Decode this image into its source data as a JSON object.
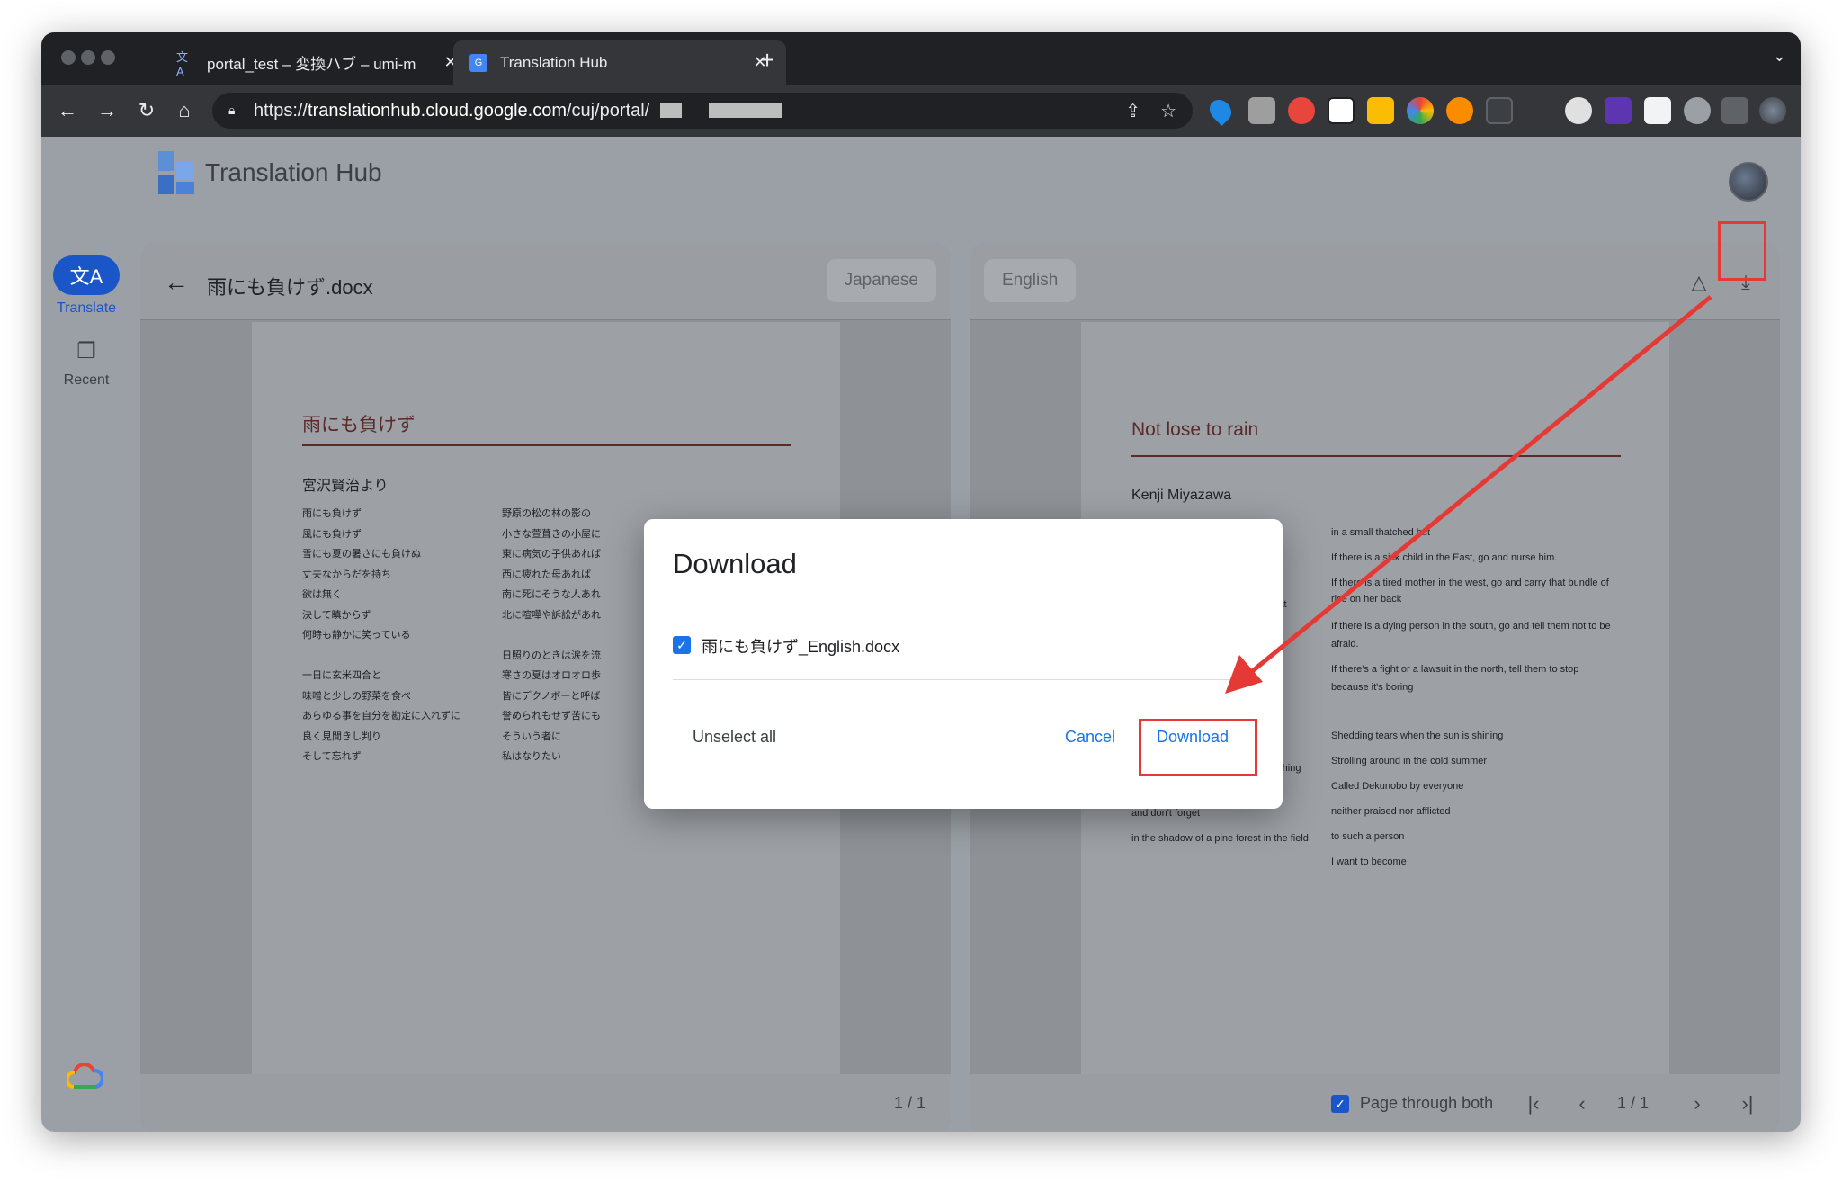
{
  "browser": {
    "tabs": [
      {
        "title": "portal_test – 変換ハブ – umi-m",
        "close": "✕"
      },
      {
        "title": "Translation Hub",
        "close": "✕"
      }
    ],
    "new_tab": "+",
    "tab_search": "⌄",
    "nav": {
      "back": "←",
      "forward": "→",
      "reload": "↻",
      "home": "⌂"
    },
    "url_prefix": "https://",
    "url_host": "translationhub.cloud.google.com",
    "url_path": "/cuj/portal/",
    "omnibox_icons": {
      "share": "⇪",
      "bookmark": "☆"
    }
  },
  "app": {
    "title": "Translation Hub",
    "rail": {
      "translate_label": "Translate",
      "recent_label": "Recent"
    },
    "left_panel": {
      "back": "←",
      "doc_title": "雨にも負けず.docx",
      "language": "Japanese",
      "doc": {
        "heading": "雨にも負けず",
        "author": "宮沢賢治より",
        "col1": [
          "雨にも負けず",
          "風にも負けず",
          "雪にも夏の暑さにも負けぬ",
          "丈夫なからだを持ち",
          "欲は無く",
          "決して瞋からず",
          "何時も静かに笑っている",
          "",
          "一日に玄米四合と",
          "味噌と少しの野菜を食べ",
          "あらゆる事を自分を勘定に入れずに",
          "良く見聞きし判り",
          "そして忘れず"
        ],
        "col2": [
          "野原の松の林の影の",
          "小さな萱葺きの小屋に",
          "東に病気の子供あれば",
          "西に疲れた母あれば",
          "南に死にそうな人あれ",
          "北に喧嘩や訴訟があれ",
          "",
          "日照りのときは涙を流",
          "寒さの夏はオロオロ歩",
          "皆にデクノボーと呼ば",
          "誉められもせず苦にも",
          "そういう者に",
          "私はなりたい"
        ]
      },
      "page_count": "1 / 1"
    },
    "right_panel": {
      "language": "English",
      "drive_icon": "△",
      "download_icon": "⤓",
      "doc": {
        "heading": "Not lose to rain",
        "author": "Kenji Miyazawa",
        "col1_partial": [
          "mmer heat",
          "day",
          "tables",
          "f in everything",
          "and don't forget",
          "in the shadow of a pine forest in the field"
        ],
        "col2": [
          "in a small thatched hut",
          "If there is a sick child in the East, go and nurse him.",
          "If there is a tired mother in the west, go and carry that bundle of",
          "rice on her back",
          "If there is a dying person in the south, go and tell them not to be",
          "afraid.",
          "If there's a fight or a lawsuit in the north, tell them to stop",
          "because it's boring",
          "Shedding tears when the sun is shining",
          "Strolling around in the cold summer",
          "Called Dekunobo by everyone",
          "neither praised nor afflicted",
          "to such a person",
          "I want to become"
        ]
      },
      "page_through_label": "Page through both",
      "pager": {
        "first": "|‹",
        "prev": "‹",
        "count": "1 / 1",
        "next": "›",
        "last": "›|"
      }
    }
  },
  "dialog": {
    "title": "Download",
    "file_name": "雨にも負けず_English.docx",
    "unselect_all": "Unselect all",
    "cancel": "Cancel",
    "download": "Download"
  },
  "colors": {
    "accent": "#1a73e8",
    "annotation": "#e53935"
  }
}
